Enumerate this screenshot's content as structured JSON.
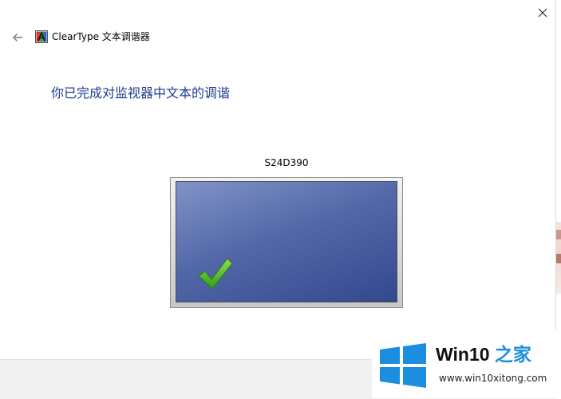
{
  "window": {
    "app_title": "ClearType 文本调谐器",
    "heading": "你已完成对监视器中文本的调谐",
    "monitor_name": "S24D390"
  },
  "icons": {
    "back": "back-arrow-icon",
    "close": "close-icon",
    "app": "cleartype-app-icon",
    "success": "checkmark-icon"
  },
  "colors": {
    "heading": "#1e3d8f",
    "screen": "#4b62a4",
    "checkmark": "#3fb21c",
    "footer": "#f0f0f0",
    "watermark_blue": "#1b8ee0"
  },
  "watermark": {
    "title_main": "Win10 ",
    "title_accent": "之家",
    "url": "www.win10xitong.com"
  }
}
